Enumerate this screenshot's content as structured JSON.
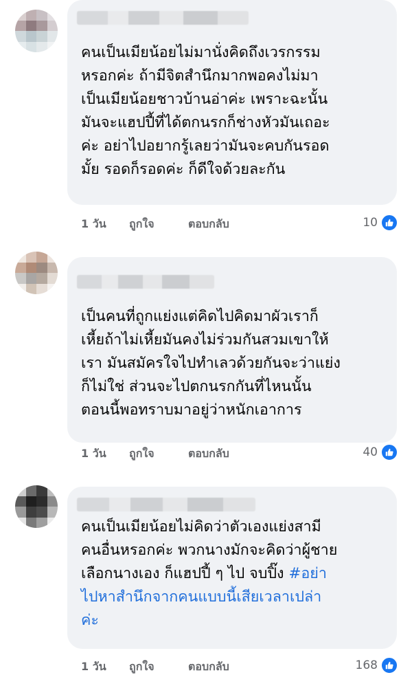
{
  "comments": [
    {
      "text": "คนเป็นเมียน้อยไม่มานั่งคิดถึงเวรกรรม\nหรอกค่ะ ถ้ามีจิตสำนึกมากพอคงไม่มา\nเป็นเมียน้อยชาวบ้านอ่าค่ะ เพราะฉะนั้น\nมันจะแฮปปี้ที่ได้ตกนรกก็ช่างหัวมันเถอะ\nค่ะ อย่าไปอยากรู้เลยว่ามันจะคบกันรอด\nมั้ย รอดก็รอดค่ะ ก็ดีใจด้วยละกัน",
      "time": "1 วัน",
      "like_label": "ถูกใจ",
      "reply_label": "ตอบกลับ",
      "reaction_count": "10"
    },
    {
      "text": "เป็นคนที่ถูกแย่งแต่คิดไปคิดมาผัวเราก็\nเหี้ยถ้าไม่เหี้ยมันคงไม่ร่วมกันสวมเขาให้\nเรา มันสมัครใจไปทำเลวด้วยกันจะว่าแย่ง\nก็ไม่ใช่ ส่วนจะไปตกนรกกันที่ไหนนั้น\nตอนนี้พอทราบมาอยู่ว่าหนักเอาการ",
      "time": "1 วัน",
      "like_label": "ถูกใจ",
      "reply_label": "ตอบกลับ",
      "reaction_count": "40"
    },
    {
      "text": "คนเป็นเมียน้อยไม่คิดว่าตัวเองแย่งสามี\nคนอื่นหรอกค่ะ พวกนางมักจะคิดว่าผู้ชาย\nเลือกนางเอง ก็แฮปปี้ ๆ ไป จบปิ๊ง ",
      "hashtag": "#อย่า\nไปหาสำนึกจากคนแบบนี้เสียเวลาเปล่า\nค่ะ",
      "time": "1 วัน",
      "like_label": "ถูกใจ",
      "reply_label": "ตอบกลับ",
      "reaction_count": "168"
    }
  ],
  "colors": {
    "bubble": "#f0f2f5",
    "text": "#050505",
    "meta": "#65676b",
    "hashtag": "#216fdb",
    "like": "#1877f2"
  },
  "icons": {
    "reaction": "thumbs-up-icon"
  }
}
